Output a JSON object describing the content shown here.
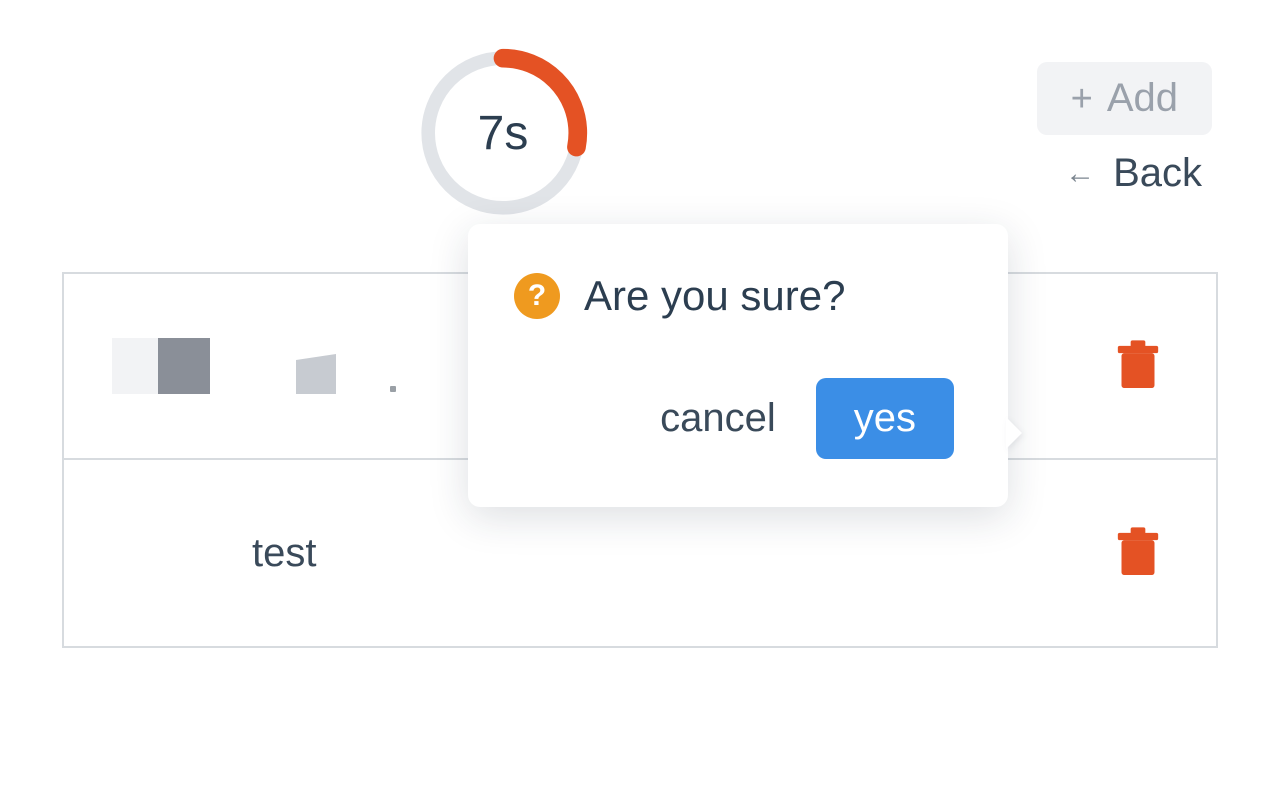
{
  "countdown": {
    "label": "7s",
    "progress_pct": 28
  },
  "actions": {
    "add_label": "Add",
    "back_label": "Back"
  },
  "rows": [
    {
      "label": ""
    },
    {
      "label": "test"
    }
  ],
  "confirm": {
    "title": "Are you sure?",
    "cancel_label": "cancel",
    "yes_label": "yes"
  },
  "colors": {
    "accent_orange": "#e45224",
    "accent_blue": "#3b8ee6",
    "warn_amber": "#ef9a1f"
  }
}
